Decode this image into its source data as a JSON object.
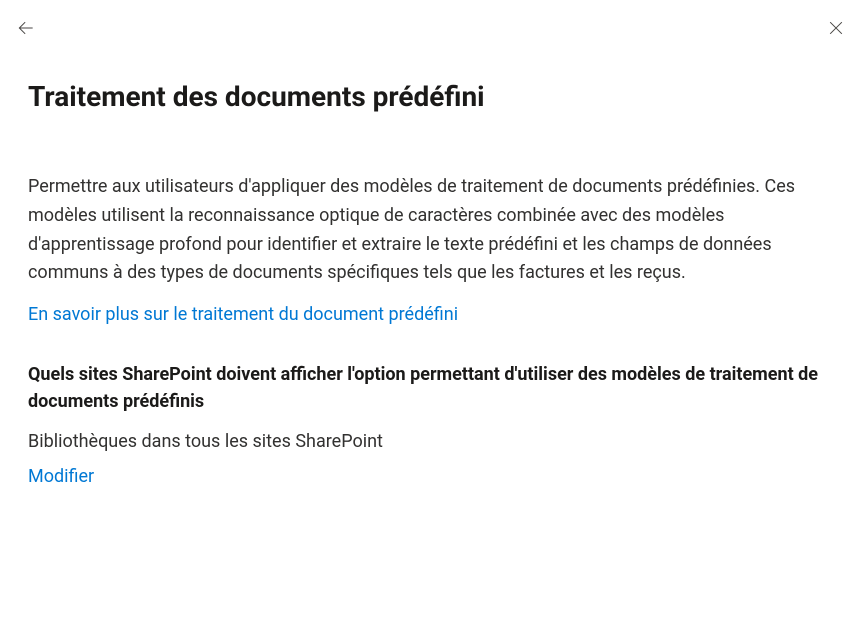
{
  "header": {
    "title": "Traitement des documents prédéfini"
  },
  "body": {
    "description": "Permettre aux utilisateurs d'appliquer des modèles de traitement de documents prédéfinies. Ces modèles utilisent la reconnaissance optique de caractères combinée avec des modèles d'apprentissage profond pour identifier et extraire le texte prédéfini et les champs de données communs à des types de documents spécifiques tels que les factures et les reçus.",
    "learnMoreLink": "En savoir plus sur le traitement du document prédéfini",
    "subheading": "Quels sites SharePoint doivent afficher l'option permettant d'utiliser des modèles de traitement de documents prédéfinis",
    "settingValue": "Bibliothèques dans tous les sites SharePoint",
    "editLink": "Modifier"
  }
}
